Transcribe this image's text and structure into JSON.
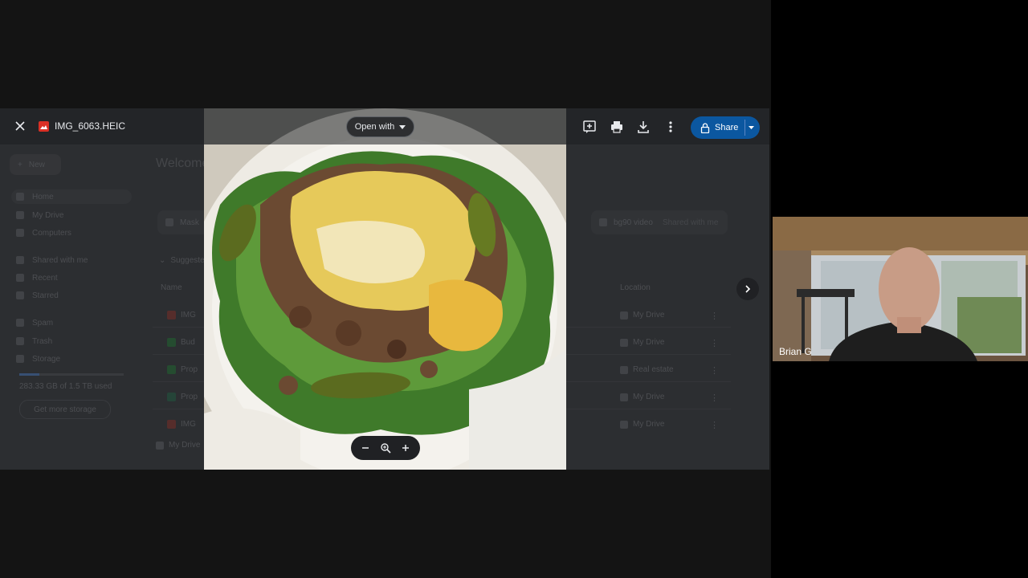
{
  "viewer": {
    "file_name": "IMG_6063.HEIC",
    "open_with_label": "Open with",
    "share_label": "Share",
    "icons": {
      "close": "close-icon",
      "file": "image-file-icon",
      "add_comment": "add-comment-icon",
      "print": "print-icon",
      "download": "download-icon",
      "more": "more-vert-icon",
      "lock": "lock-icon",
      "next": "chevron-right-icon",
      "zoom_out": "minus-icon",
      "zoom": "zoom-icon",
      "zoom_in": "plus-icon"
    }
  },
  "drive_background": {
    "new_label": "New",
    "nav": [
      "Home",
      "My Drive",
      "Computers",
      "Shared with me",
      "Recent",
      "Starred",
      "Spam",
      "Trash",
      "Storage"
    ],
    "storage_text": "283.33 GB of 1.5 TB used",
    "get_storage_label": "Get more storage",
    "welcome": "Welcome to Drive",
    "suggested_label": "Suggested",
    "folder_cards": [
      {
        "name": "Mask",
        "sub": "In My Drive"
      },
      {
        "name": "bg90 video",
        "sub": "Shared with me"
      }
    ],
    "column_name": "Name",
    "column_location": "Location",
    "rows": [
      {
        "name": "IMG",
        "location": "My Drive"
      },
      {
        "name": "Bud",
        "location": "My Drive"
      },
      {
        "name": "Prop",
        "location": "Real estate"
      },
      {
        "name": "Prop",
        "location": "My Drive"
      },
      {
        "name": "IMG",
        "location": "My Drive"
      }
    ],
    "footer_item": "My Drive"
  },
  "video_tile": {
    "participant_name": "Brian G"
  },
  "colors": {
    "share_button": "#0b57a0",
    "file_icon": "#d93025"
  }
}
